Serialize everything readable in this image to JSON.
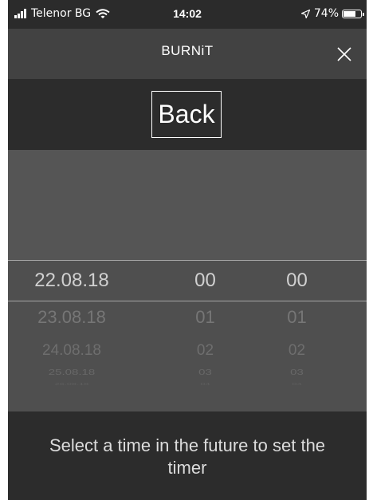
{
  "status_bar": {
    "carrier": "Telenor BG",
    "time": "14:02",
    "battery": "74%",
    "battery_level": 0.74
  },
  "nav": {
    "title": "BURNiT",
    "close_icon": "close-icon"
  },
  "back_label": "Back",
  "picker": {
    "dates": [
      "22.08.18",
      "23.08.18",
      "24.08.18",
      "25.08.18",
      "26.08.18"
    ],
    "hours": [
      "00",
      "01",
      "02",
      "03",
      "04"
    ],
    "minutes": [
      "00",
      "01",
      "02",
      "03",
      "04"
    ]
  },
  "footer_text": "Select a time in the future to set the timer",
  "colors": {
    "status_bg": "#2b2b2b",
    "nav_bg": "#424242",
    "back_bar_bg": "#2c2c2c",
    "picker_bg": "#4f4f4f",
    "footer_bg": "#2c2c2c"
  }
}
